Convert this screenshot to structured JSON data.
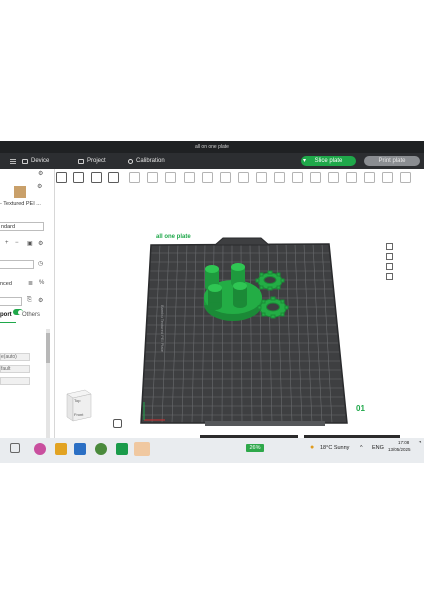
{
  "window": {
    "title": "all on one plate"
  },
  "menu": {
    "device_label": "Device",
    "project_label": "Project",
    "calibration_label": "Calibration",
    "slice_label": "Slice plate",
    "print_label": "Print plate"
  },
  "left_panel": {
    "plate_type": "- Textured PEI ...",
    "process_preset": "ndard",
    "advanced_label": "nced",
    "tabs": {
      "support": "port",
      "others": "Others"
    },
    "options": [
      "e(auto)",
      "fault"
    ]
  },
  "viewport": {
    "plate_label": "all one plate",
    "plate_number": "01",
    "bed_brand_text": "Bambu Textured PEI Plate",
    "navcube": {
      "top": "Top",
      "front": "Front"
    },
    "colors": {
      "bed": "#3e3f41",
      "grid": "#6b6d70",
      "model": "#1e9a3e",
      "accent": "#1fa84a"
    }
  },
  "taskbar": {
    "battery": "26%",
    "weather": "18°C  Sunny",
    "language": "ENG",
    "time": "17:08",
    "date": "13/05/2025"
  }
}
